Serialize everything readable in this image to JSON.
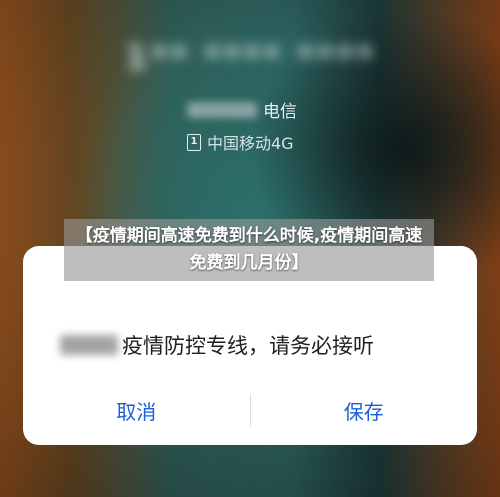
{
  "incoming_call": {
    "phone_number": "1** **** ****",
    "carrier_label": "电信",
    "sim_slot": "1",
    "network_label": "中国移动4G"
  },
  "dialog": {
    "message_suffix": "疫情防控专线，请务必接听",
    "cancel_label": "取消",
    "save_label": "保存"
  },
  "article": {
    "title": "【疫情期间高速免费到什么时候,疫情期间高速免费到几月份】"
  },
  "colors": {
    "accent": "#1a5fd8",
    "dialog_bg": "#ffffff",
    "banner_bg": "#969696"
  }
}
